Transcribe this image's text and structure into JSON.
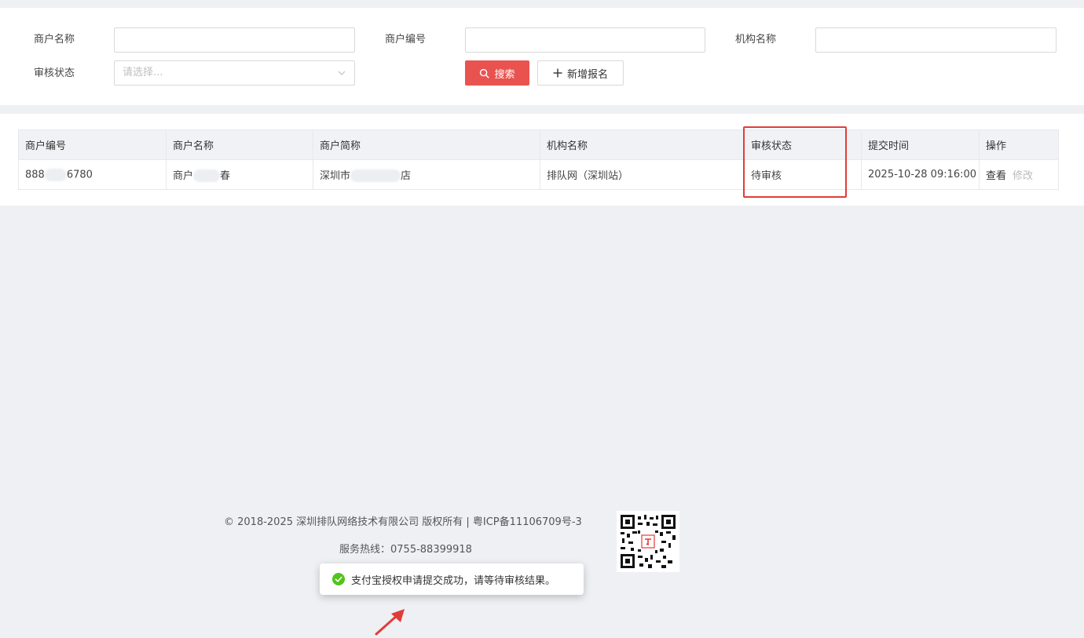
{
  "filters": {
    "merchant_name_label": "商户名称",
    "merchant_no_label": "商户编号",
    "org_name_label": "机构名称",
    "status_label": "审核状态",
    "status_placeholder": "请选择...",
    "search_button": "搜索",
    "add_button": "新增报名"
  },
  "table": {
    "headers": [
      "商户编号",
      "商户名称",
      "商户简称",
      "机构名称",
      "审核状态",
      "提交时间",
      "操作"
    ],
    "row": {
      "merchant_no_prefix": "888",
      "merchant_no_suffix": "6780",
      "merchant_name_prefix": "商户",
      "merchant_name_suffix": "春",
      "short_name_prefix": "深圳市",
      "short_name_suffix": "店",
      "org_name": "排队网（深圳站）",
      "status": "待审核",
      "submit_time": "2025-10-28 09:16:00",
      "action_view": "查看",
      "action_edit": "修改"
    }
  },
  "footer": {
    "copyright": "© 2018-2025 深圳排队网络技术有限公司 版权所有 | 粤ICP备11106709号-3",
    "hotline": "服务热线：0755-88399918"
  },
  "toast": {
    "message": "支付宝授权申请提交成功，请等待审核结果。"
  },
  "colors": {
    "primary": "#e9534f",
    "highlight": "#e23c39",
    "success": "#52c41a"
  }
}
